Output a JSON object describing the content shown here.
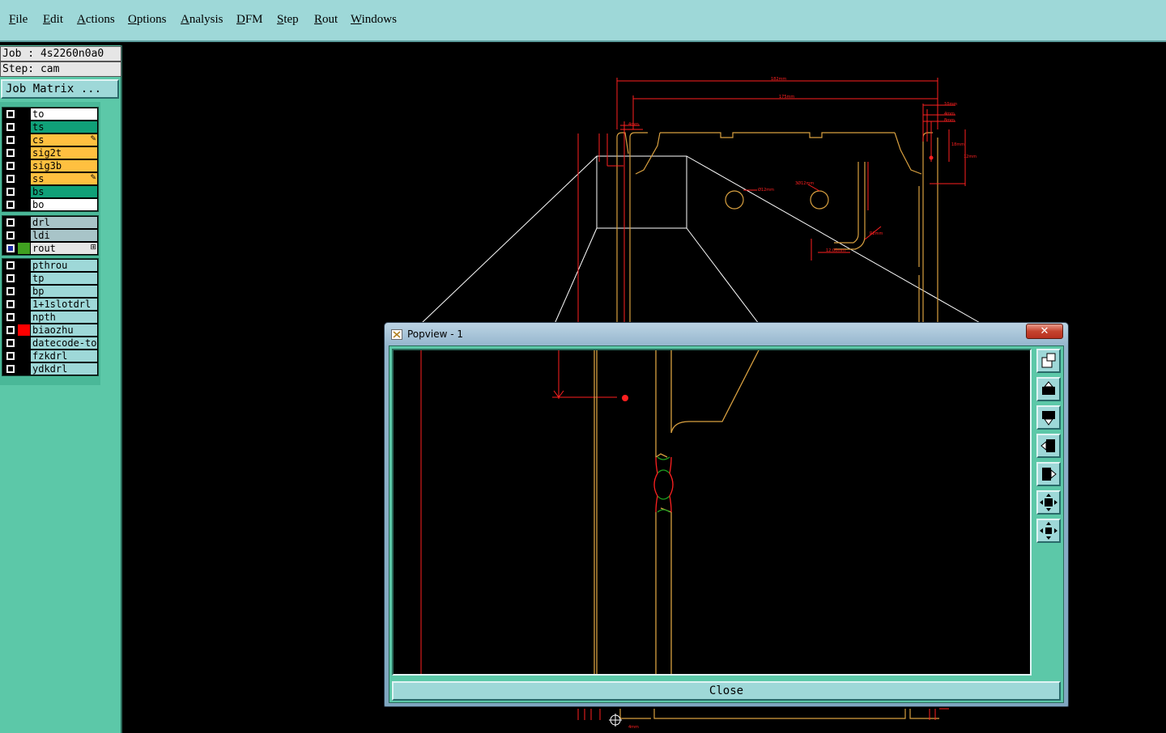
{
  "menu": {
    "items": [
      "File",
      "Edit",
      "Actions",
      "Options",
      "Analysis",
      "DFM",
      "Step",
      "Rout",
      "Windows"
    ]
  },
  "job": {
    "job_line": "Job : 4s2260n0a0",
    "step_line": "Step: cam",
    "matrix_button": "Job Matrix ..."
  },
  "layers": {
    "group1": [
      {
        "name": "to",
        "color": "#ffffff",
        "mark": ""
      },
      {
        "name": "ts",
        "color": "#10a078",
        "mark": ""
      },
      {
        "name": "cs",
        "color": "#ffc040",
        "mark": "✎"
      },
      {
        "name": "sig2t",
        "color": "#ffc040",
        "mark": ""
      },
      {
        "name": "sig3b",
        "color": "#ffc040",
        "mark": ""
      },
      {
        "name": "ss",
        "color": "#ffc040",
        "mark": "✎"
      },
      {
        "name": "bs",
        "color": "#10a078",
        "mark": ""
      },
      {
        "name": "bo",
        "color": "#ffffff",
        "mark": ""
      }
    ],
    "group2": [
      {
        "name": "drl",
        "color": "#a8c4c8",
        "mark": ""
      },
      {
        "name": "ldi",
        "color": "#a8c4c8",
        "mark": ""
      },
      {
        "name": "rout",
        "color": "#e6e6e6",
        "mark": "⊞",
        "checked": true,
        "swatch": "#40a020"
      }
    ],
    "group3": [
      {
        "name": "pthrou",
        "color": "#9ed8d8",
        "mark": ""
      },
      {
        "name": "tp",
        "color": "#9ed8d8",
        "mark": ""
      },
      {
        "name": "bp",
        "color": "#9ed8d8",
        "mark": ""
      },
      {
        "name": "1+1slotdrl",
        "color": "#9ed8d8",
        "mark": ""
      },
      {
        "name": "npth",
        "color": "#9ed8d8",
        "mark": ""
      },
      {
        "name": "biaozhu",
        "color": "#9ed8d8",
        "mark": "",
        "swatch": "#ff0000"
      },
      {
        "name": "datecode-to",
        "color": "#9ed8d8",
        "mark": ""
      },
      {
        "name": "fzkdrl",
        "color": "#9ed8d8",
        "mark": ""
      },
      {
        "name": "ydkdrl",
        "color": "#9ed8d8",
        "mark": ""
      }
    ]
  },
  "popview": {
    "title": "Popview - 1",
    "close_x": "✕",
    "close_label": "Close",
    "tools": [
      "zoom-window-icon",
      "pan-up-icon",
      "pan-down-icon",
      "pan-left-icon",
      "pan-right-icon",
      "zoom-fit-icon",
      "zoom-center-icon"
    ]
  },
  "canvas": {
    "dimensions": [
      "182mm",
      "175mm",
      "10mm",
      "4mm",
      "8mm",
      "4mm",
      "18mm",
      "12mm",
      "Ø12mm",
      "3Ø12mm",
      "12.00mm",
      "R2mm",
      "4mm"
    ]
  },
  "colors": {
    "outline": "#d8a040",
    "dimension": "#ff2020",
    "zoom_lines": "#ffffff",
    "green_tab": "#20a020",
    "menubar": "#9ed8d8",
    "panel": "#5cc8a8"
  }
}
